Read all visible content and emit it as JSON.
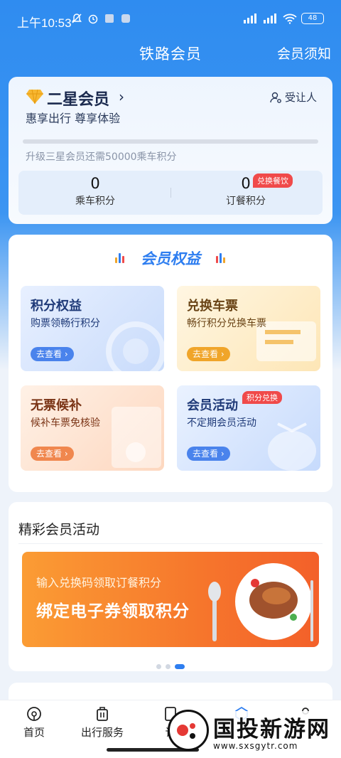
{
  "status_bar": {
    "time": "上午10:53",
    "battery": "48"
  },
  "navbar": {
    "title": "铁路会员",
    "right_link": "会员须知"
  },
  "member": {
    "level": "二星会员",
    "slogan": "惠享出行 尊享体验",
    "yield_person": "受让人",
    "upgrade_text": "升级三星会员还需50000乘车积分",
    "progress": 0.0,
    "ride_points": {
      "value": "0",
      "label": "乘车积分"
    },
    "dining_points": {
      "value": "0",
      "label": "订餐积分",
      "badge": "兑换餐饮"
    }
  },
  "benefits": {
    "title": "会员权益",
    "tiles": [
      {
        "title": "积分权益",
        "subtitle": "购票领畅行积分",
        "button": "去查看"
      },
      {
        "title": "兑换车票",
        "subtitle": "畅行积分兑换车票",
        "button": "去查看"
      },
      {
        "title": "无票候补",
        "subtitle": "候补车票免核验",
        "button": "去查看"
      },
      {
        "title": "会员活动",
        "subtitle": "不定期会员活动",
        "button": "去查看",
        "badge": "积分兑换"
      }
    ]
  },
  "activities": {
    "title": "精彩会员活动",
    "banner_line1": "输入兑换码领取订餐积分",
    "banner_line2": "绑定电子券领取积分",
    "carousel_index": 3,
    "carousel_count": 3
  },
  "bottom_nav": [
    {
      "label": "首页",
      "icon": "home-icon"
    },
    {
      "label": "出行服务",
      "icon": "luggage-icon"
    },
    {
      "label": "订",
      "icon": "ticket-icon"
    },
    {
      "label": "",
      "icon": "member-icon"
    },
    {
      "label": "",
      "icon": "person-icon"
    }
  ],
  "watermark": {
    "text": "国投新游网",
    "url": "www.sxsgytr.com"
  },
  "colors": {
    "brand_blue": "#2e7ef0",
    "badge_red": "#f04a4a"
  }
}
